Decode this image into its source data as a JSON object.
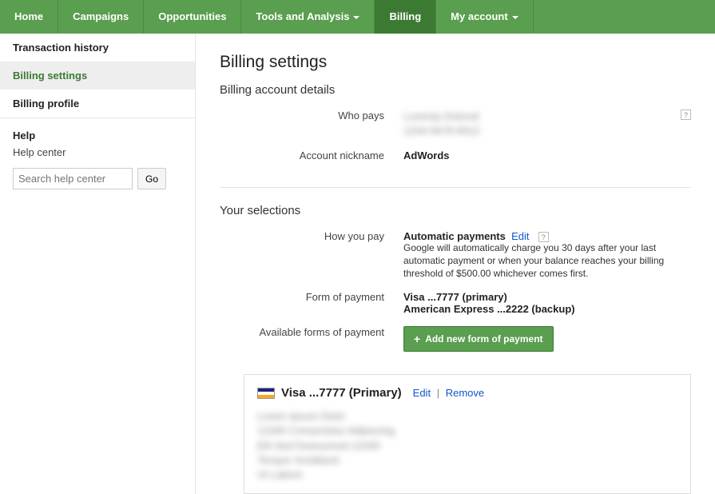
{
  "nav": {
    "home": "Home",
    "campaigns": "Campaigns",
    "opportunities": "Opportunities",
    "tools": "Tools and Analysis",
    "billing": "Billing",
    "account": "My account"
  },
  "sidebar": {
    "transaction_history": "Transaction history",
    "billing_settings": "Billing settings",
    "billing_profile": "Billing profile",
    "help_heading": "Help",
    "help_center": "Help center",
    "search_placeholder": "Search help center",
    "go_label": "Go"
  },
  "page": {
    "title": "Billing settings",
    "details_heading": "Billing account details",
    "who_pays_label": "Who pays",
    "nickname_label": "Account nickname",
    "nickname_value": "AdWords",
    "selections_heading": "Your selections",
    "how_pay_label": "How you pay",
    "how_pay_value": "Automatic payments",
    "edit_label": "Edit",
    "how_pay_desc": "Google will automatically charge you 30 days after your last automatic payment or when your balance reaches your billing threshold of $500.00 whichever comes first.",
    "form_pay_label": "Form of payment",
    "form_pay_primary": "Visa ...7777 (primary)",
    "form_pay_backup": "American Express ...2222 (backup)",
    "avail_label": "Available forms of payment",
    "add_button": "Add new form of payment",
    "card_title": "Visa ...7777  (Primary)",
    "remove_label": "Remove"
  }
}
